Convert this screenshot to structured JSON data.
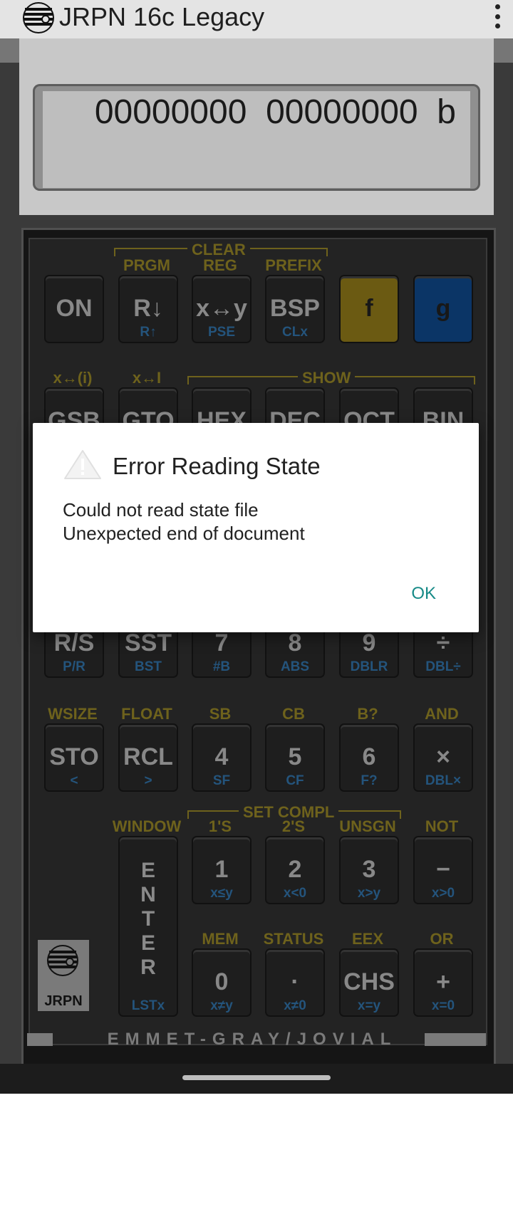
{
  "app": {
    "title": "JRPN 16c Legacy"
  },
  "display": {
    "text": "00000000  00000000  b"
  },
  "keyboard": {
    "bracket_labels": {
      "clear": "CLEAR",
      "show": "SHOW",
      "set_compl": "SET COMPL"
    },
    "row1_flabels": [
      "",
      "PRGM",
      "REG",
      "PREFIX",
      "",
      ""
    ],
    "row1": [
      {
        "label": "ON",
        "sub": ""
      },
      {
        "label": "R↓",
        "sub": "R↑"
      },
      {
        "label": "x↔y",
        "sub": "PSE"
      },
      {
        "label": "BSP",
        "sub": "CLx"
      },
      {
        "label": "f",
        "sub": ""
      },
      {
        "label": "g",
        "sub": ""
      }
    ],
    "row2_flabels": [
      "x↔(i)",
      "x↔I",
      "",
      "",
      "",
      ""
    ],
    "row2": [
      {
        "label": "GSB"
      },
      {
        "label": "GTO"
      },
      {
        "label": "HEX"
      },
      {
        "label": "DEC"
      },
      {
        "label": "OCT"
      },
      {
        "label": "BIN"
      }
    ],
    "row4": [
      {
        "label": "R/S",
        "sub": "P/R"
      },
      {
        "label": "SST",
        "sub": "BST"
      },
      {
        "label": "7",
        "sub": "#B"
      },
      {
        "label": "8",
        "sub": "ABS"
      },
      {
        "label": "9",
        "sub": "DBLR"
      },
      {
        "label": "÷",
        "sub": "DBL÷"
      }
    ],
    "row5_flabels": [
      "WSIZE",
      "FLOAT",
      "SB",
      "CB",
      "B?",
      "AND"
    ],
    "row5": [
      {
        "label": "STO",
        "sub": "<"
      },
      {
        "label": "RCL",
        "sub": ">"
      },
      {
        "label": "4",
        "sub": "SF"
      },
      {
        "label": "5",
        "sub": "CF"
      },
      {
        "label": "6",
        "sub": "F?"
      },
      {
        "label": "×",
        "sub": "DBL×"
      }
    ],
    "row6_flabels": [
      "",
      "WINDOW",
      "1'S",
      "2'S",
      "UNSGN",
      "NOT"
    ],
    "row6": [
      {
        "label": "1",
        "sub": "x≤y"
      },
      {
        "label": "2",
        "sub": "x<0"
      },
      {
        "label": "3",
        "sub": "x>y"
      },
      {
        "label": "−",
        "sub": "x>0"
      }
    ],
    "enter": {
      "letters": [
        "E",
        "N",
        "T",
        "E",
        "R"
      ],
      "sub": "LSTx"
    },
    "row7_flabels": [
      "",
      "",
      "MEM",
      "STATUS",
      "EEX",
      "OR"
    ],
    "row7": [
      {
        "label": "0",
        "sub": "x≠y"
      },
      {
        "label": "·",
        "sub": "x≠0"
      },
      {
        "label": "CHS",
        "sub": "x=y"
      },
      {
        "label": "+",
        "sub": "x=0"
      }
    ],
    "logo_text": "JRPN",
    "brand": "EMMET-GRAY/JOVIAL"
  },
  "dialog": {
    "title": "Error Reading State",
    "message_line1": "Could not read state file",
    "message_line2": "Unexpected end of document",
    "ok_label": "OK"
  }
}
